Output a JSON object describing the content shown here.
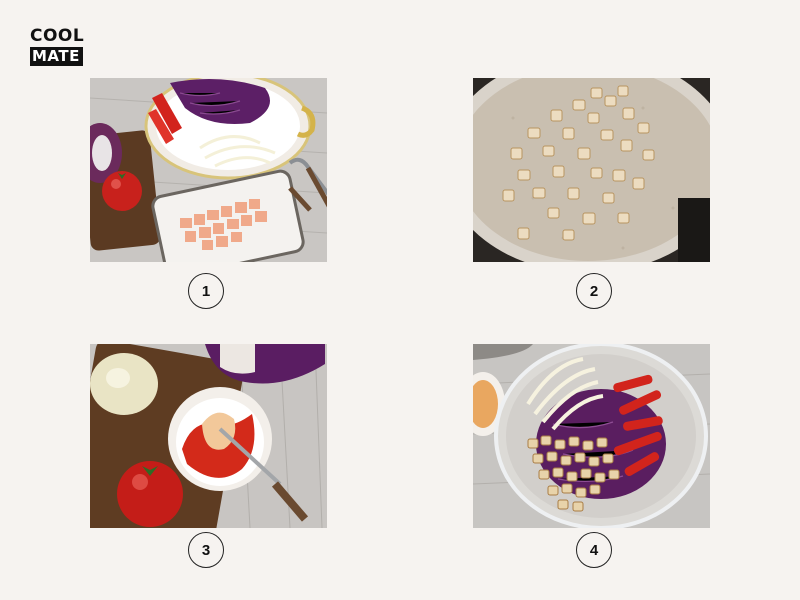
{
  "logo": {
    "top_text": "COOL",
    "bottom_text": "MATE"
  },
  "steps": [
    {
      "number": "1"
    },
    {
      "number": "2"
    },
    {
      "number": "3"
    },
    {
      "number": "4"
    }
  ],
  "colors": {
    "background": "#f6f3f0",
    "circle_border": "#222222"
  }
}
